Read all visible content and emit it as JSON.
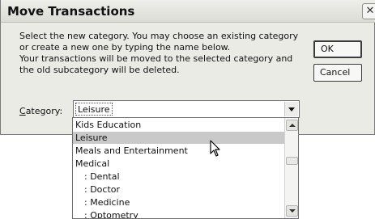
{
  "dialog": {
    "title": "Move Transactions",
    "close_label": "✕"
  },
  "message": {
    "lines": [
      "Select the new category. You may choose an existing category",
      "or create a new one by typing the name below.",
      "Your transactions will be moved to the selected category and",
      "the old subcategory will be deleted."
    ]
  },
  "buttons": {
    "ok": "OK",
    "cancel": "Cancel"
  },
  "category": {
    "label_underlined": "C",
    "label_rest": "ategory:",
    "value": "Leisure"
  },
  "dropdown": {
    "items": [
      "Kids Education",
      "Leisure",
      "Meals and Entertainment",
      "Medical",
      ": Dental",
      ": Doctor",
      ": Medicine",
      ": Optometry"
    ],
    "selected_index": 1
  }
}
